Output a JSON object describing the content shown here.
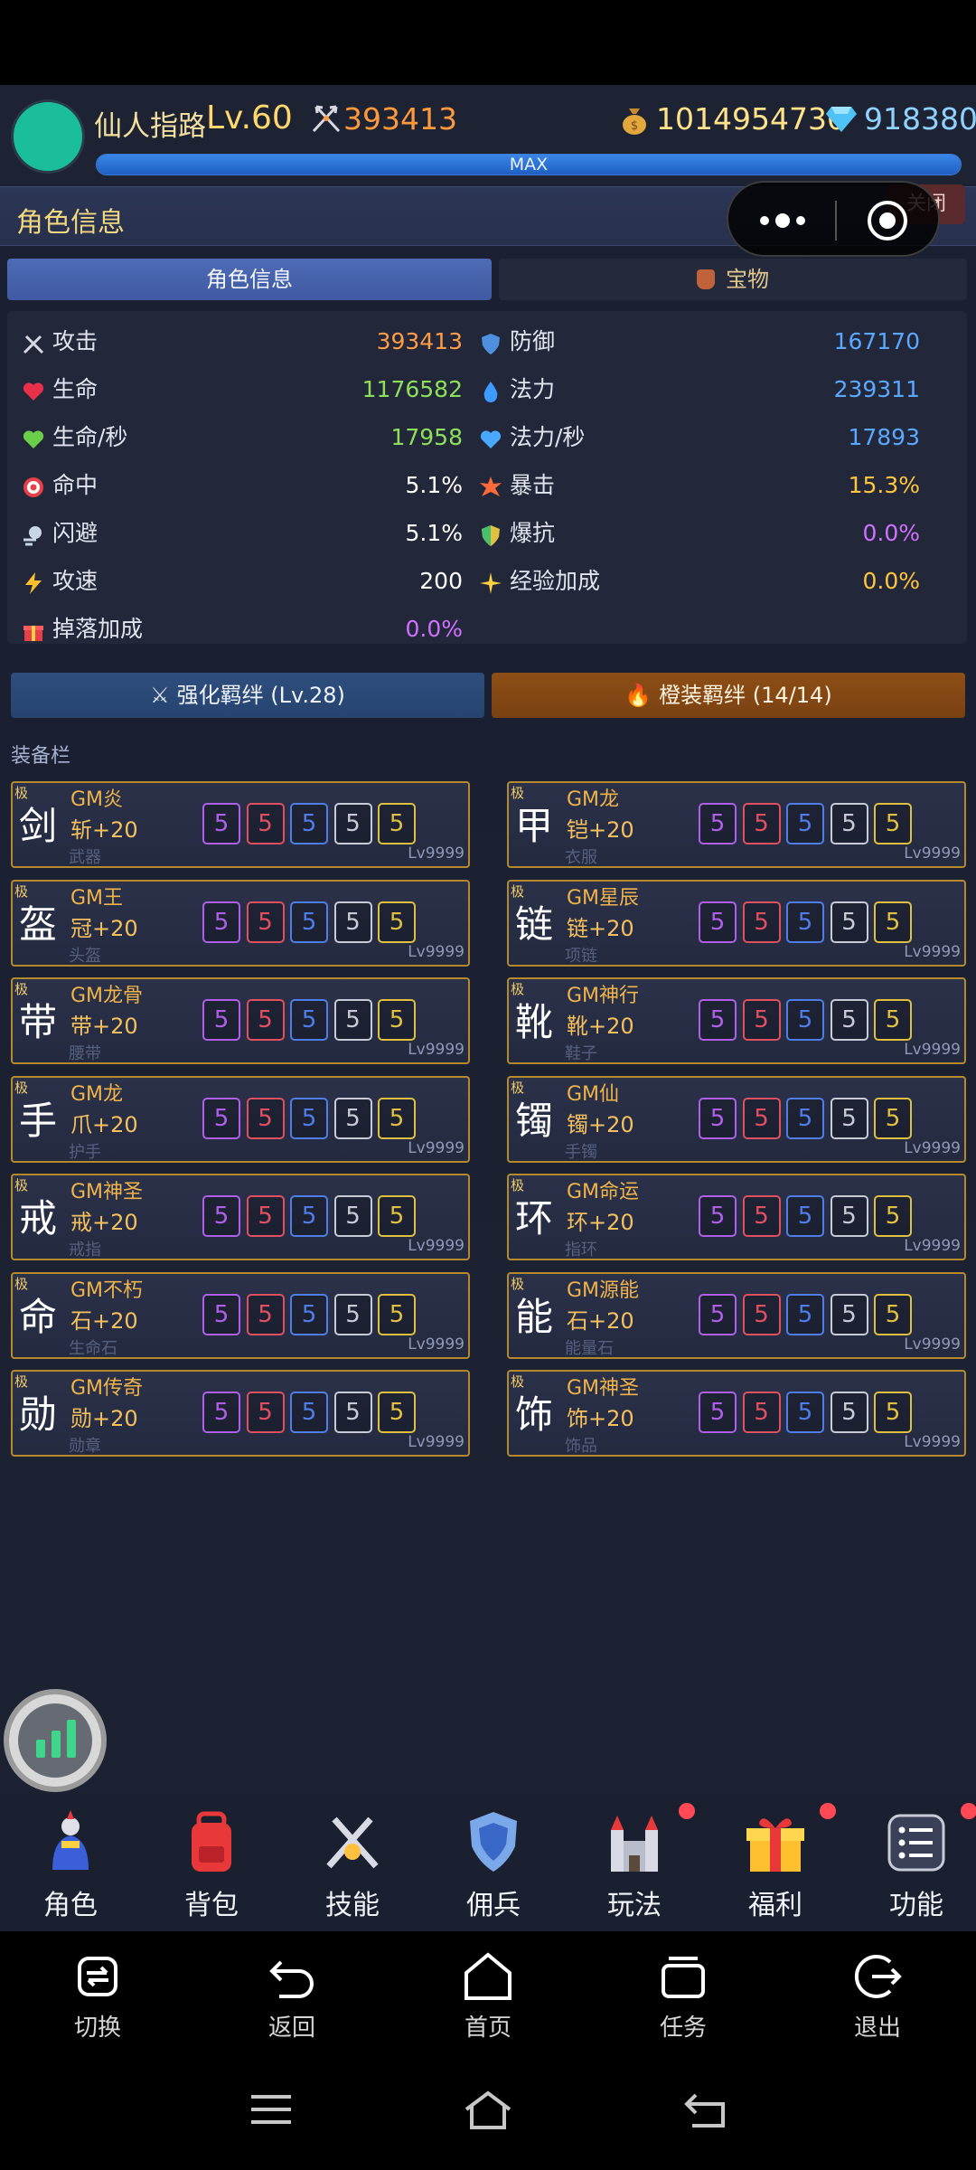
{
  "player": {
    "name": "仙人指路",
    "level": "Lv.60",
    "power": "393413",
    "gold": "1014954730",
    "diamonds": "918380",
    "xp_label": "MAX",
    "xp_fraction": 1.0
  },
  "panel": {
    "title": "角色信息",
    "close_label": "关闭"
  },
  "tabs": [
    "角色信息",
    "宝物"
  ],
  "stats": [
    {
      "label": "攻击",
      "value": "393413",
      "color": "#ff9c45",
      "icon": "swords-icon"
    },
    {
      "label": "防御",
      "value": "167170",
      "color": "#5aa8ff",
      "icon": "shield-icon"
    },
    {
      "label": "生命",
      "value": "1176582",
      "color": "#8ee05a",
      "icon": "heart-icon"
    },
    {
      "label": "法力",
      "value": "239311",
      "color": "#5aa8ff",
      "icon": "droplet-icon"
    },
    {
      "label": "生命/秒",
      "value": "17958",
      "color": "#8ee05a",
      "icon": "green-heart-icon"
    },
    {
      "label": "法力/秒",
      "value": "17893",
      "color": "#5aa8ff",
      "icon": "blue-heart-icon"
    },
    {
      "label": "命中",
      "value": "5.1%",
      "color": "#ffffff",
      "icon": "target-icon"
    },
    {
      "label": "暴击",
      "value": "15.3%",
      "color": "#ffc53d",
      "icon": "burst-icon"
    },
    {
      "label": "闪避",
      "value": "5.1%",
      "color": "#ffffff",
      "icon": "dash-icon"
    },
    {
      "label": "爆抗",
      "value": "0.0%",
      "color": "#d070ff",
      "icon": "shield-badge-icon"
    },
    {
      "label": "攻速",
      "value": "200",
      "color": "#ffffff",
      "icon": "lightning-icon"
    },
    {
      "label": "经验加成",
      "value": "0.0%",
      "color": "#ffc53d",
      "icon": "sparkle-icon"
    },
    {
      "label": "掉落加成",
      "value": "0.0%",
      "color": "#d070ff",
      "icon": "gift-icon"
    }
  ],
  "bonds": {
    "enhance": "强化羁绊 (Lv.28)",
    "orange": "橙装羁绊 (14/14)"
  },
  "equipment_label": "装备栏",
  "equipment": [
    {
      "grade": "极",
      "glyph": "剑",
      "name1": "GM炎",
      "name2": "斩+20",
      "type": "武器",
      "lv": "Lv9999"
    },
    {
      "grade": "极",
      "glyph": "甲",
      "name1": "GM龙",
      "name2": "铠+20",
      "type": "衣服",
      "lv": "Lv9999"
    },
    {
      "grade": "极",
      "glyph": "盔",
      "name1": "GM王",
      "name2": "冠+20",
      "type": "头盔",
      "lv": "Lv9999"
    },
    {
      "grade": "极",
      "glyph": "链",
      "name1": "GM星辰",
      "name2": "链+20",
      "type": "项链",
      "lv": "Lv9999"
    },
    {
      "grade": "极",
      "glyph": "带",
      "name1": "GM龙骨",
      "name2": "带+20",
      "type": "腰带",
      "lv": "Lv9999"
    },
    {
      "grade": "极",
      "glyph": "靴",
      "name1": "GM神行",
      "name2": "靴+20",
      "type": "鞋子",
      "lv": "Lv9999"
    },
    {
      "grade": "极",
      "glyph": "手",
      "name1": "GM龙",
      "name2": "爪+20",
      "type": "护手",
      "lv": "Lv9999"
    },
    {
      "grade": "极",
      "glyph": "镯",
      "name1": "GM仙",
      "name2": "镯+20",
      "type": "手镯",
      "lv": "Lv9999"
    },
    {
      "grade": "极",
      "glyph": "戒",
      "name1": "GM神圣",
      "name2": "戒+20",
      "type": "戒指",
      "lv": "Lv9999"
    },
    {
      "grade": "极",
      "glyph": "环",
      "name1": "GM命运",
      "name2": "环+20",
      "type": "指环",
      "lv": "Lv9999"
    },
    {
      "grade": "极",
      "glyph": "命",
      "name1": "GM不朽",
      "name2": "石+20",
      "type": "生命石",
      "lv": "Lv9999"
    },
    {
      "grade": "极",
      "glyph": "能",
      "name1": "GM源能",
      "name2": "石+20",
      "type": "能量石",
      "lv": "Lv9999"
    },
    {
      "grade": "极",
      "glyph": "勋",
      "name1": "GM传奇",
      "name2": "勋+20",
      "type": "勋章",
      "lv": "Lv9999"
    },
    {
      "grade": "极",
      "glyph": "饰",
      "name1": "GM神圣",
      "name2": "饰+20",
      "type": "饰品",
      "lv": "Lv9999"
    }
  ],
  "gem_slots": [
    {
      "value": "5",
      "color": "#b060e8"
    },
    {
      "value": "5",
      "color": "#e05060"
    },
    {
      "value": "5",
      "color": "#4f7ee8"
    },
    {
      "value": "5",
      "color": "#c8cbd6"
    },
    {
      "value": "5",
      "color": "#e0c040"
    }
  ],
  "bottom_nav": [
    {
      "label": "角色",
      "icon": "knight-icon",
      "badge": false
    },
    {
      "label": "背包",
      "icon": "backpack-icon",
      "badge": false
    },
    {
      "label": "技能",
      "icon": "crossed-swords-icon",
      "badge": false
    },
    {
      "label": "佣兵",
      "icon": "shield-emblem-icon",
      "badge": false
    },
    {
      "label": "玩法",
      "icon": "castle-icon",
      "badge": true
    },
    {
      "label": "福利",
      "icon": "gift-box-icon",
      "badge": true
    },
    {
      "label": "功能",
      "icon": "menu-list-icon",
      "badge": true
    }
  ],
  "browser_bar": [
    "切换",
    "返回",
    "首页",
    "任务",
    "退出"
  ]
}
